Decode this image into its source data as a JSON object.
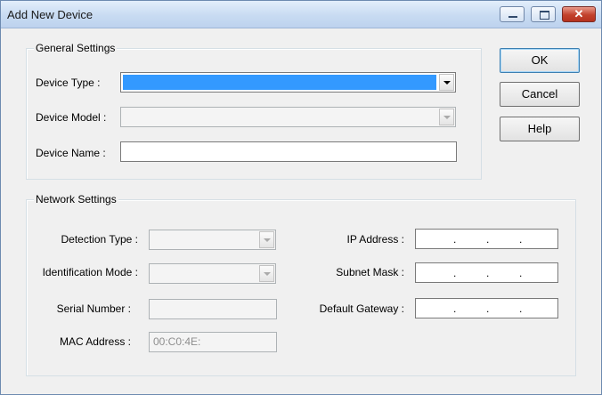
{
  "window": {
    "title": "Add New Device",
    "close_glyph": "✕"
  },
  "general": {
    "legend": "General Settings",
    "device_type_label": "Device Type :",
    "device_model_label": "Device Model :",
    "device_name_label": "Device Name :",
    "device_name_value": ""
  },
  "network": {
    "legend": "Network Settings",
    "detection_type_label": "Detection Type :",
    "identification_mode_label": "Identification Mode :",
    "serial_number_label": "Serial Number :",
    "mac_address_label": "MAC Address :",
    "mac_address_value": "00:C0:4E:",
    "ip_address_label": "IP Address :",
    "subnet_mask_label": "Subnet Mask :",
    "default_gateway_label": "Default Gateway :",
    "ip_dot": "."
  },
  "buttons": {
    "ok": "OK",
    "cancel": "Cancel",
    "help": "Help"
  },
  "icons": [
    "minimize-icon",
    "maximize-icon",
    "close-icon",
    "dropdown-arrow-icon"
  ],
  "colors": {
    "selection": "#3399ff",
    "title_bar": "#c8dbf2",
    "close_button": "#c2412c",
    "dialog_bg": "#f0f0f0"
  }
}
